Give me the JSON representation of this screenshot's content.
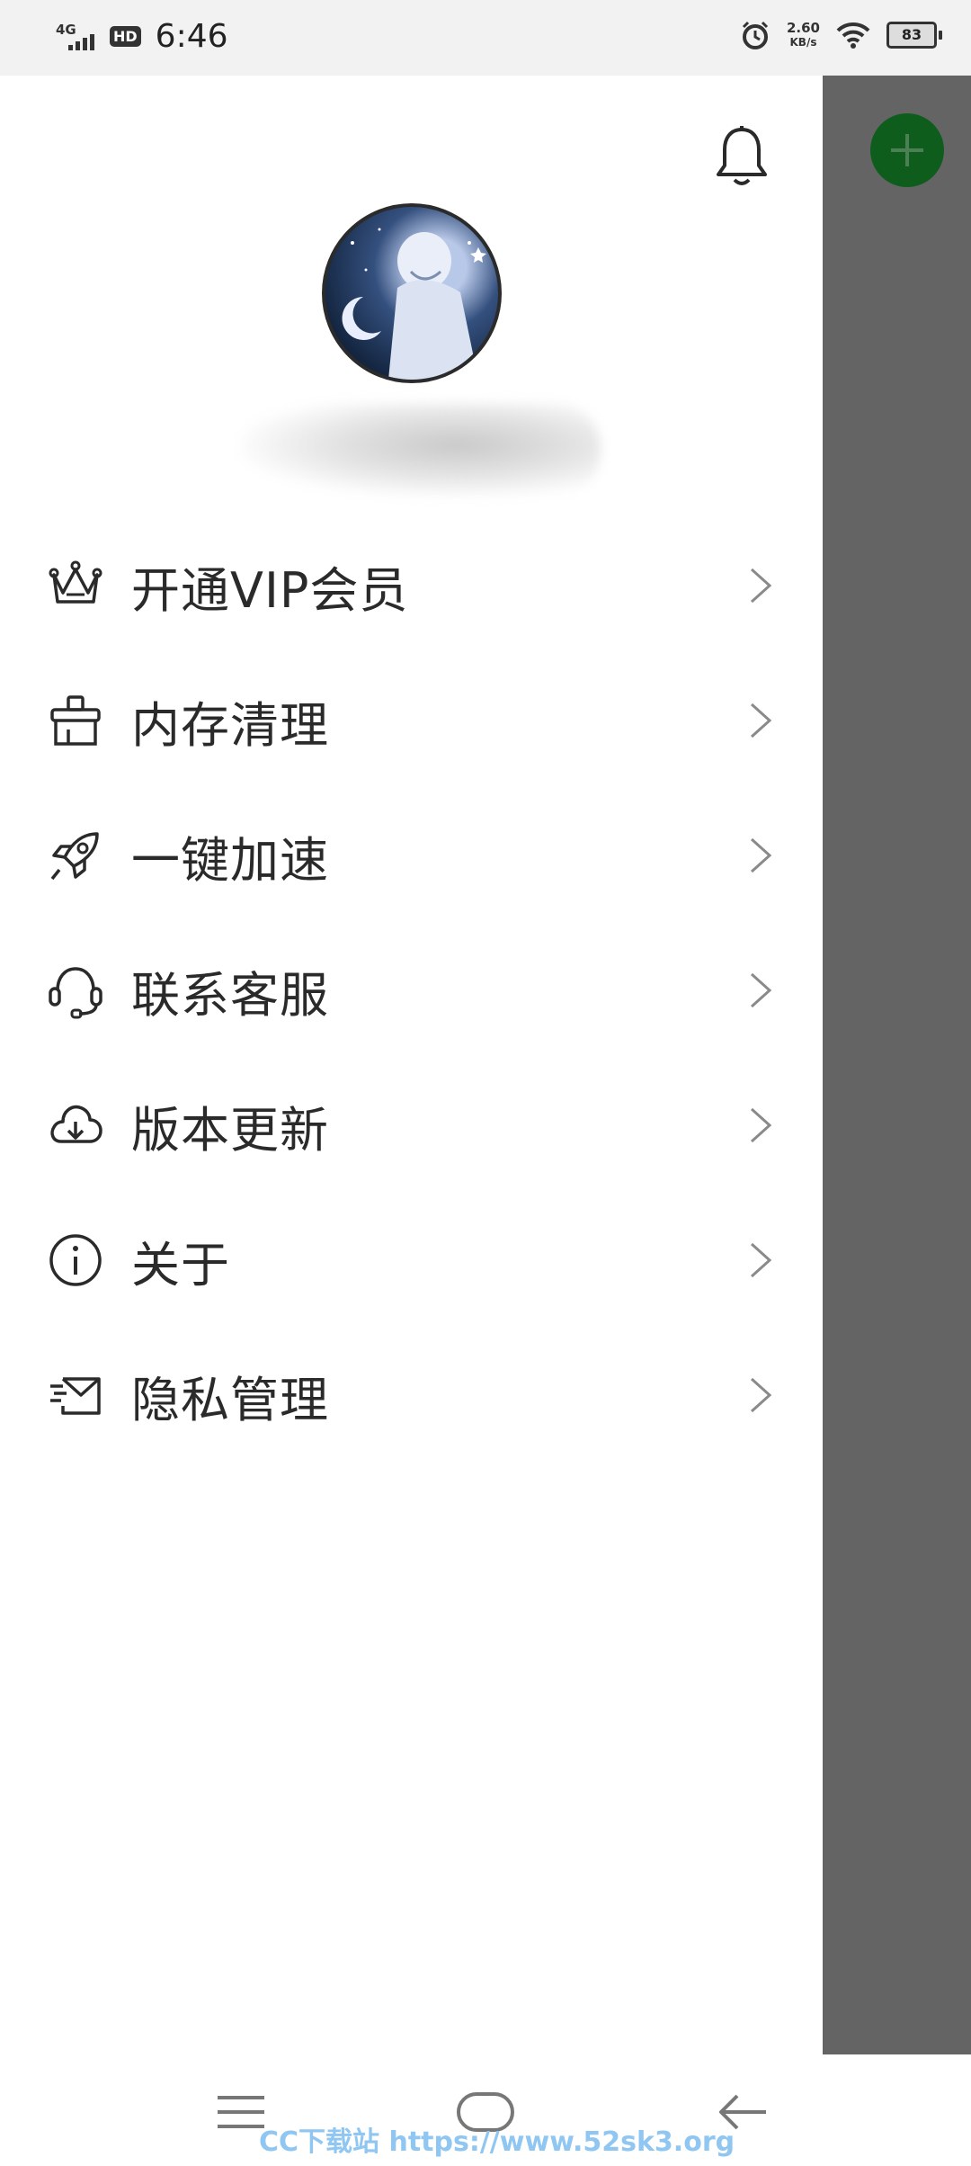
{
  "status_bar": {
    "network": "4G",
    "hd": "HD",
    "time": "6:46",
    "speed_value": "2.60",
    "speed_unit": "KB/s",
    "battery": "83"
  },
  "drawer": {
    "menu": [
      {
        "label": "开通VIP会员",
        "icon": "crown-icon"
      },
      {
        "label": "内存清理",
        "icon": "broom-icon"
      },
      {
        "label": "一键加速",
        "icon": "rocket-icon"
      },
      {
        "label": "联系客服",
        "icon": "headset-icon"
      },
      {
        "label": "版本更新",
        "icon": "cloud-download-icon"
      },
      {
        "label": "关于",
        "icon": "info-icon"
      },
      {
        "label": "隐私管理",
        "icon": "mail-icon"
      }
    ]
  },
  "colors": {
    "fab": "#0f5d1d",
    "scrim": "#646464",
    "text": "#2a2a2a"
  },
  "watermark": "CC下载站 https://www.52sk3.org"
}
